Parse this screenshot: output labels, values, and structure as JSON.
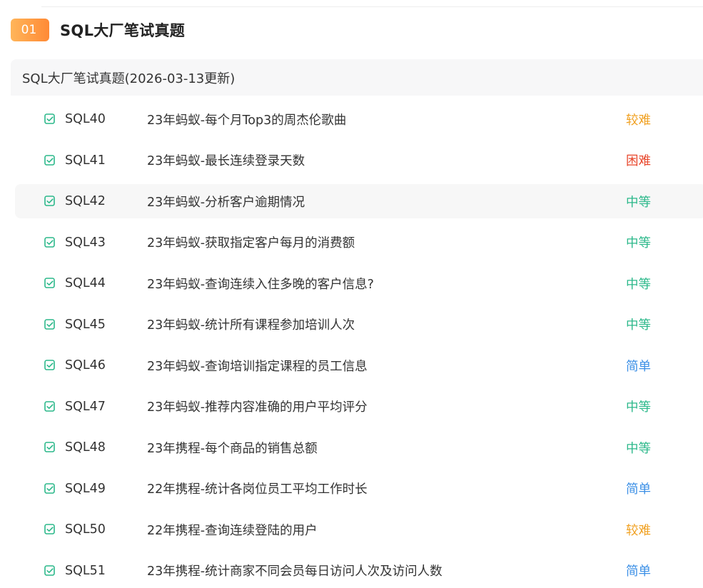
{
  "section": {
    "badge": "01",
    "title": "SQL大厂笔试真题"
  },
  "card": {
    "header": "SQL大厂笔试真题(2026-03-13更新)"
  },
  "colors": {
    "easy": "#3b8fe6",
    "medium": "#2bb88a",
    "hard_ish": "#f0a020",
    "hard": "#e8472c",
    "check_icon": "#2bb88a",
    "badge_start": "#ffb55a",
    "badge_end": "#ff8a35"
  },
  "problems": [
    {
      "id": "SQL40",
      "title": "23年蚂蚁-每个月Top3的周杰伦歌曲",
      "difficulty": "较难",
      "icon": "check-square-icon"
    },
    {
      "id": "SQL41",
      "title": "23年蚂蚁-最长连续登录天数",
      "difficulty": "困难",
      "icon": "check-square-icon"
    },
    {
      "id": "SQL42",
      "title": "23年蚂蚁-分析客户逾期情况",
      "difficulty": "中等",
      "icon": "check-square-icon"
    },
    {
      "id": "SQL43",
      "title": "23年蚂蚁-获取指定客户每月的消费额",
      "difficulty": "中等",
      "icon": "check-square-icon"
    },
    {
      "id": "SQL44",
      "title": "23年蚂蚁-查询连续入住多晚的客户信息?",
      "difficulty": "中等",
      "icon": "check-square-icon"
    },
    {
      "id": "SQL45",
      "title": "23年蚂蚁-统计所有课程参加培训人次",
      "difficulty": "中等",
      "icon": "check-square-icon"
    },
    {
      "id": "SQL46",
      "title": "23年蚂蚁-查询培训指定课程的员工信息",
      "difficulty": "简单",
      "icon": "check-square-icon"
    },
    {
      "id": "SQL47",
      "title": "23年蚂蚁-推荐内容准确的用户平均评分",
      "difficulty": "中等",
      "icon": "check-square-icon"
    },
    {
      "id": "SQL48",
      "title": "23年携程-每个商品的销售总额",
      "difficulty": "中等",
      "icon": "check-square-icon"
    },
    {
      "id": "SQL49",
      "title": "22年携程-统计各岗位员工平均工作时长",
      "difficulty": "简单",
      "icon": "check-square-icon"
    },
    {
      "id": "SQL50",
      "title": "22年携程-查询连续登陆的用户",
      "difficulty": "较难",
      "icon": "check-square-icon"
    },
    {
      "id": "SQL51",
      "title": "23年携程-统计商家不同会员每日访问人次及访问人数",
      "difficulty": "简单",
      "icon": "check-square-icon"
    }
  ]
}
